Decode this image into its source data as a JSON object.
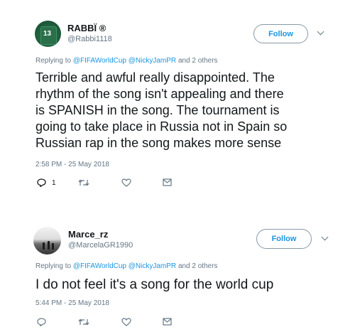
{
  "tweet1": {
    "name": "RABBÏ ®",
    "handle": "@Rabbi1118",
    "avatar_number": "13",
    "follow_label": "Follow",
    "replying_prefix": "Replying to",
    "replying_to_1": "@FIFAWorldCup",
    "replying_to_2": "@NickyJamPR",
    "replying_suffix": "and 2 others",
    "text_lines": [
      "Terrible and awful really disappointed. The",
      "rhythm of the song isn't appealing and there",
      "is SPANISH in the song. The tournament is",
      "going to take place in Russia not in Spain so",
      "Russian rap in the song makes more sense"
    ],
    "timestamp": "2:58 PM - 25 May 2018",
    "reply_count": "1",
    "icons": [
      "reply-icon",
      "retweet-icon",
      "like-icon",
      "message-icon"
    ]
  },
  "tweet2": {
    "name": "Marce_rz",
    "handle": "@MarcelaGR1990",
    "follow_label": "Follow",
    "replying_prefix": "Replying to",
    "replying_to_1": "@FIFAWorldCup",
    "replying_to_2": "@NickyJamPR",
    "replying_suffix": "and 2 others",
    "text": "I do not feel it's a song for the world cup",
    "timestamp": "5:44 PM - 25 May 2018",
    "icons": [
      "reply-icon",
      "retweet-icon",
      "like-icon",
      "message-icon"
    ]
  },
  "colors": {
    "link": "#1b95e0",
    "muted": "#657786",
    "text": "#14171a"
  }
}
